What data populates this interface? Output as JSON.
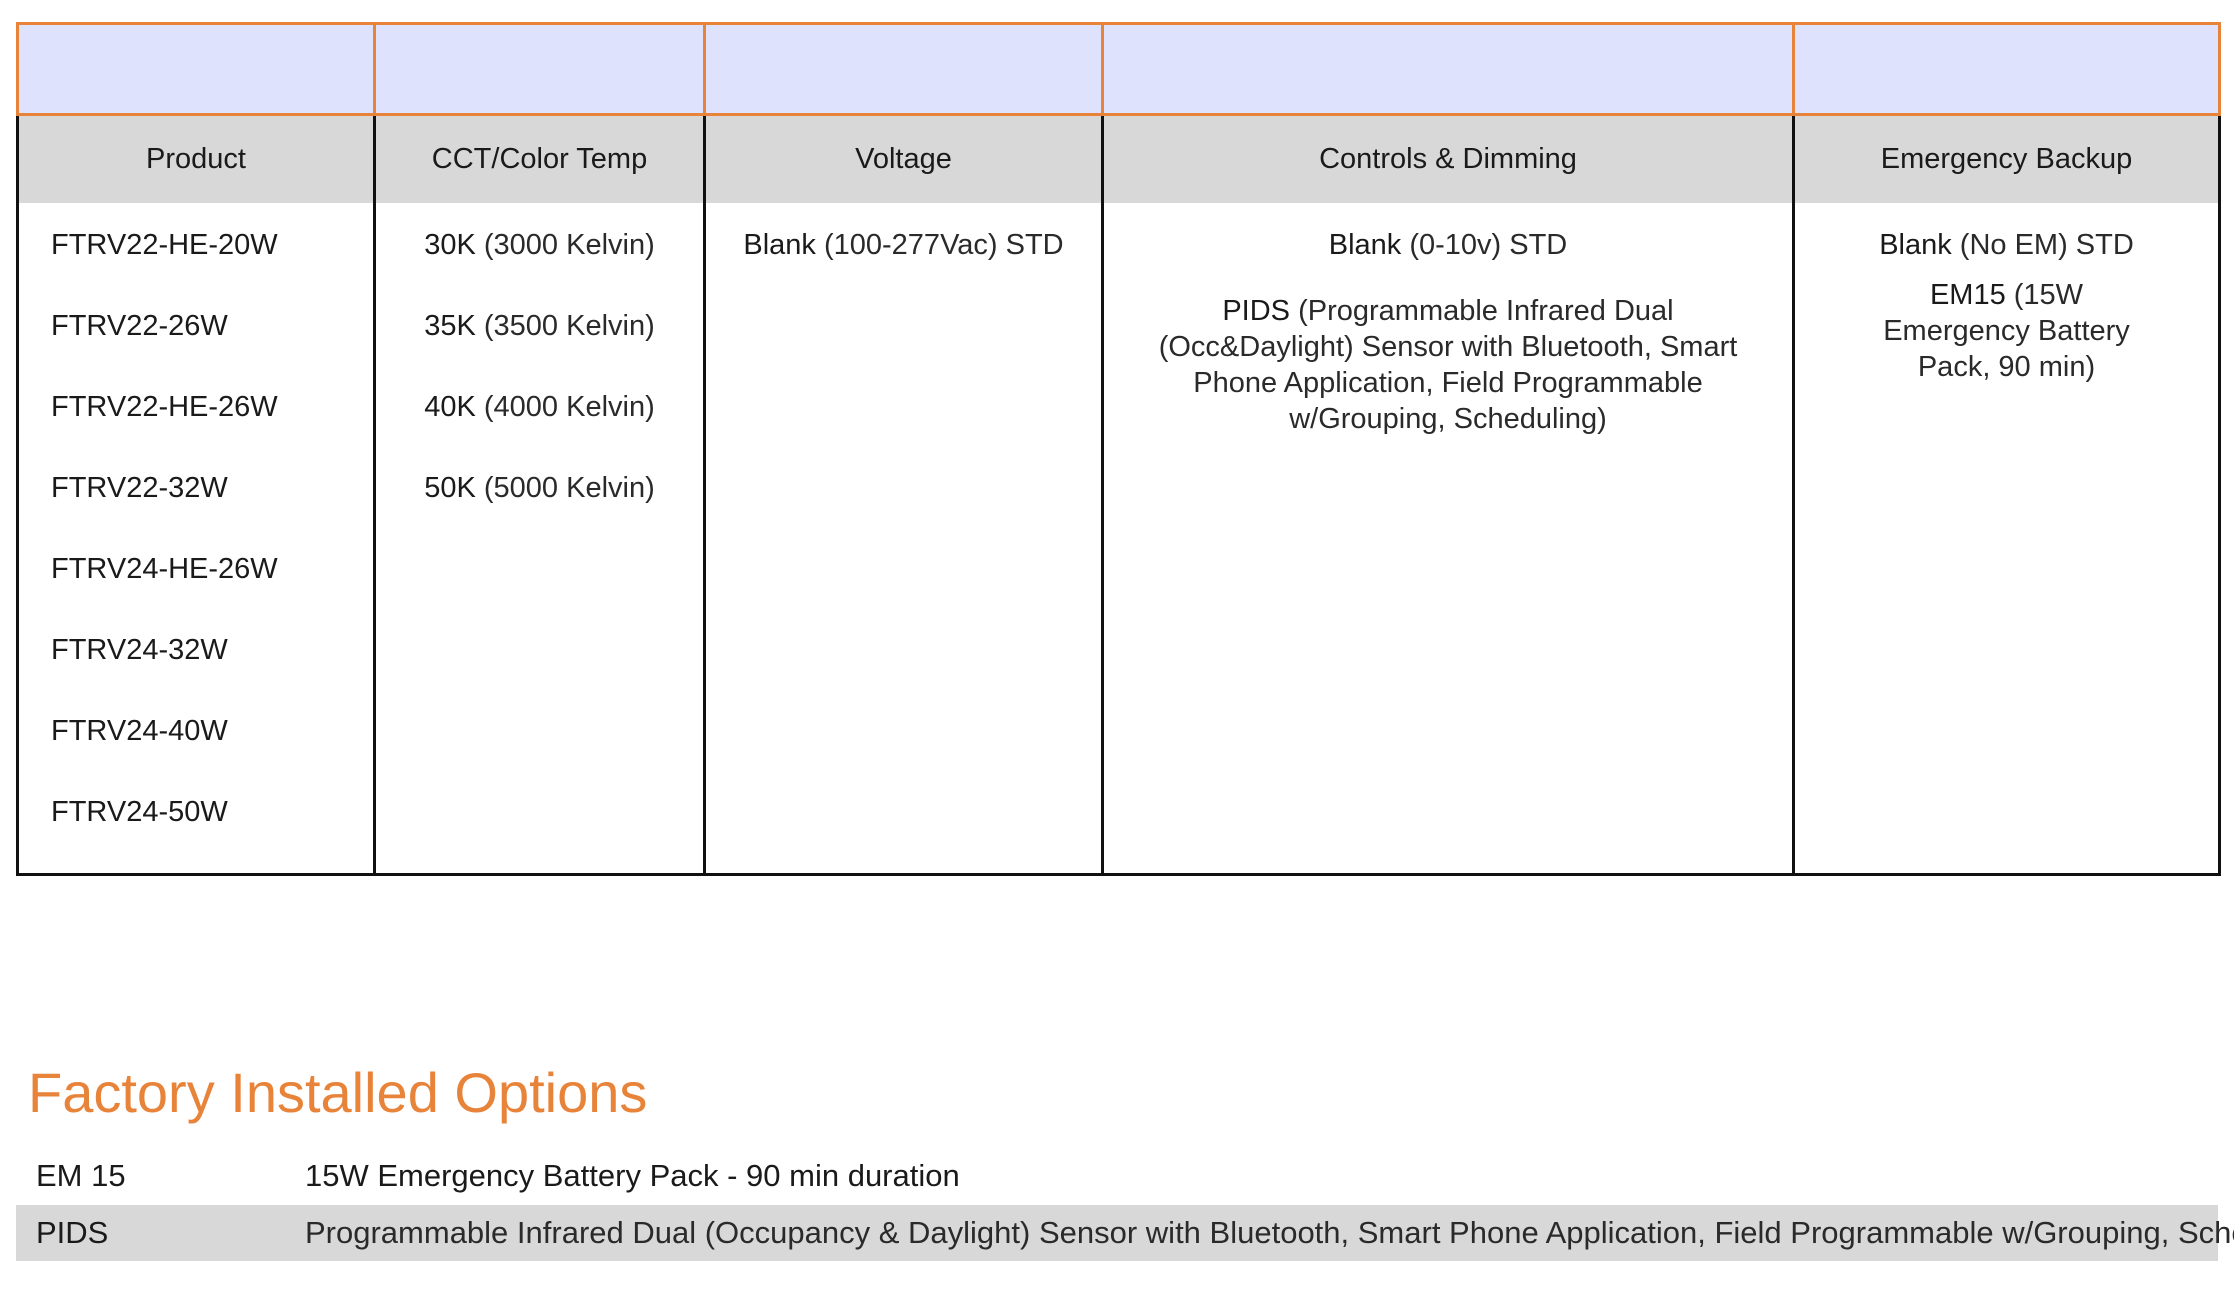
{
  "table": {
    "headers": [
      "Product",
      "CCT/Color Temp",
      "Voltage",
      "Controls & Dimming",
      "Emergency Backup"
    ],
    "products": [
      "FTRV22-HE-20W",
      "FTRV22-26W",
      "FTRV22-HE-26W",
      "FTRV22-32W",
      "FTRV24-HE-26W",
      "FTRV24-32W",
      "FTRV24-40W",
      "FTRV24-50W"
    ],
    "cct": [
      {
        "code": "30K",
        "desc": " (3000 Kelvin)"
      },
      {
        "code": "35K",
        "desc": " (3500 Kelvin)"
      },
      {
        "code": "40K",
        "desc": " (4000 Kelvin)"
      },
      {
        "code": "50K",
        "desc": " (5000 Kelvin)"
      }
    ],
    "voltage": [
      {
        "code": "Blank",
        "desc": " (100-277Vac) STD"
      }
    ],
    "controls": [
      {
        "code": "Blank",
        "desc": " (0-10v) STD"
      },
      {
        "code": "PIDS",
        "desc": " (Programmable Infrared Dual (Occ&Daylight) Sensor with Bluetooth, Smart Phone Application, Field Programmable w/Grouping, Scheduling)"
      }
    ],
    "emergency": [
      {
        "code": "Blank",
        "desc": " (No EM) STD"
      },
      {
        "code": "EM15",
        "desc": " (15W Emergency Battery Pack, 90 min)"
      }
    ]
  },
  "options": {
    "title": "Factory Installed Options",
    "rows": [
      {
        "code": "EM 15",
        "desc": "15W Emergency Battery Pack - 90 min duration"
      },
      {
        "code": "PIDS",
        "desc": "Programmable Infrared Dual (Occupancy & Daylight) Sensor with Bluetooth, Smart Phone Application, Field Programmable w/Grouping, Scheduling"
      }
    ]
  },
  "colors": {
    "accent_orange": "#e8833a",
    "header_blue": "#dfe2fd",
    "header_gray": "#d8d8d8"
  }
}
